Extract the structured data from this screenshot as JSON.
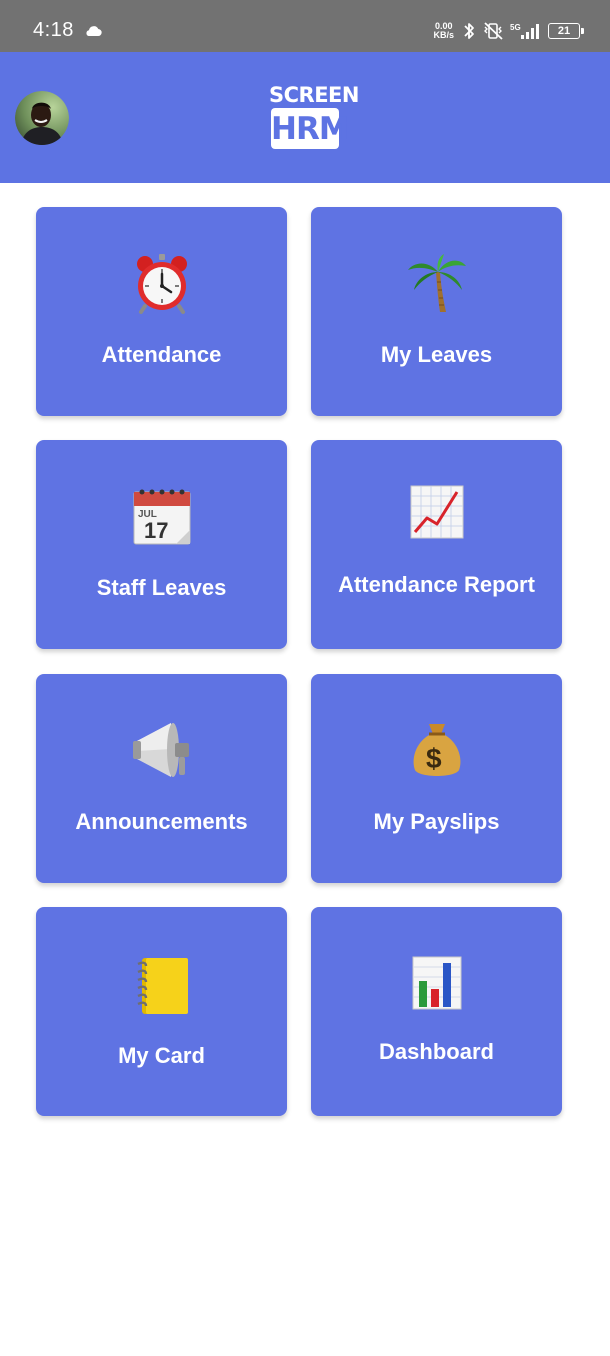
{
  "status_bar": {
    "time": "4:18",
    "net_speed_value": "0.00",
    "net_speed_unit": "KB/s",
    "network_type": "5G",
    "battery": "21"
  },
  "header": {
    "logo_top": "SCREEN",
    "logo_bottom": "HRM",
    "accent_color": "#5d73e3"
  },
  "menu": {
    "items": [
      {
        "label": "Attendance",
        "icon": "alarm-clock-icon"
      },
      {
        "label": "My Leaves",
        "icon": "palm-tree-icon"
      },
      {
        "label": "Staff Leaves",
        "icon": "calendar-icon"
      },
      {
        "label": "Attendance Report",
        "icon": "chart-increasing-icon"
      },
      {
        "label": "Announcements",
        "icon": "megaphone-icon"
      },
      {
        "label": "My Payslips",
        "icon": "money-bag-icon"
      },
      {
        "label": "My Card",
        "icon": "notebook-icon"
      },
      {
        "label": "Dashboard",
        "icon": "bar-chart-icon"
      }
    ]
  }
}
